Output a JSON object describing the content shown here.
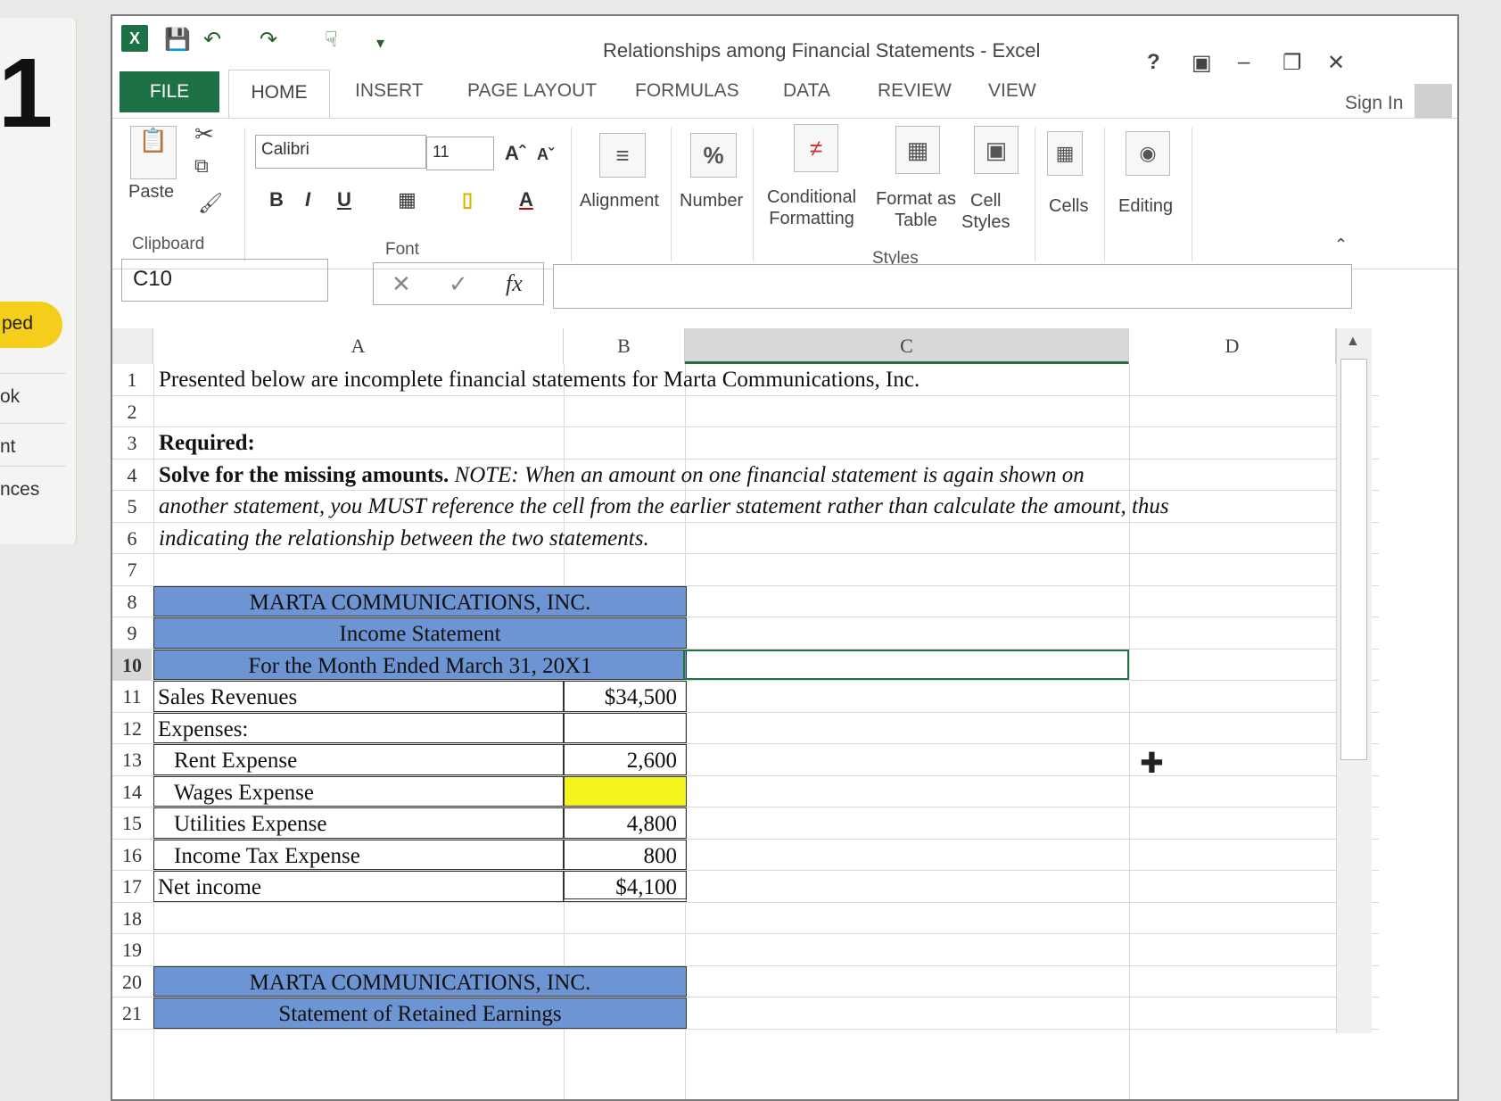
{
  "background": {
    "big_digit": "1",
    "pill_label": "ped",
    "nav_items": [
      "ok",
      "nt",
      "nces"
    ]
  },
  "window": {
    "title": "Relationships among Financial Statements - Excel",
    "help": "?",
    "sign_in": "Sign In"
  },
  "tabs": [
    "FILE",
    "HOME",
    "INSERT",
    "PAGE LAYOUT",
    "FORMULAS",
    "DATA",
    "REVIEW",
    "VIEW"
  ],
  "ribbon": {
    "clipboard": {
      "paste": "Paste",
      "label": "Clipboard"
    },
    "font": {
      "name": "Calibri",
      "size": "11",
      "label": "Font"
    },
    "alignment": "Alignment",
    "number": {
      "label": "Number",
      "icon_text": "%"
    },
    "styles": {
      "conditional_1": "Conditional",
      "conditional_2": "Formatting",
      "format_table_1": "Format as",
      "format_table_2": "Table",
      "cell_styles_1": "Cell",
      "cell_styles_2": "Styles",
      "label": "Styles"
    },
    "cells": "Cells",
    "editing": "Editing"
  },
  "formula_bar": {
    "name_box": "C10",
    "formula": ""
  },
  "columns": [
    "A",
    "B",
    "C",
    "D"
  ],
  "sheet": {
    "r1": "Presented below are incomplete financial statements for Marta Communications, Inc.",
    "r3": "Required:",
    "r4_bold": "Solve for the missing amounts.",
    "r4_italic": "NOTE:  When an amount on one financial statement is again shown on",
    "r5": "another statement, you MUST reference the cell from the earlier statement rather than calculate the amount, thus",
    "r6": "indicating the relationship between the two statements.",
    "r8": "MARTA COMMUNICATIONS, INC.",
    "r9": "Income Statement",
    "r10": "For the Month Ended  March 31, 20X1",
    "r11_label": "Sales Revenues",
    "r11_value": "$34,500",
    "r12_label": "Expenses:",
    "r13_label": "Rent Expense",
    "r13_value": "2,600",
    "r14_label": "Wages Expense",
    "r14_value": "",
    "r15_label": "Utilities Expense",
    "r15_value": "4,800",
    "r16_label": "Income Tax Expense",
    "r16_value": "800",
    "r17_label": "Net income",
    "r17_value": "$4,100",
    "r20": "MARTA COMMUNICATIONS, INC.",
    "r21": "Statement of Retained Earnings"
  },
  "row_numbers": [
    "1",
    "2",
    "3",
    "4",
    "5",
    "6",
    "7",
    "8",
    "9",
    "10",
    "11",
    "12",
    "13",
    "14",
    "15",
    "16",
    "17",
    "18",
    "19",
    "20",
    "21"
  ],
  "colors": {
    "excel_green": "#1e7145",
    "header_blue": "#6d95d4",
    "highlight_yellow": "#f5f51c"
  }
}
